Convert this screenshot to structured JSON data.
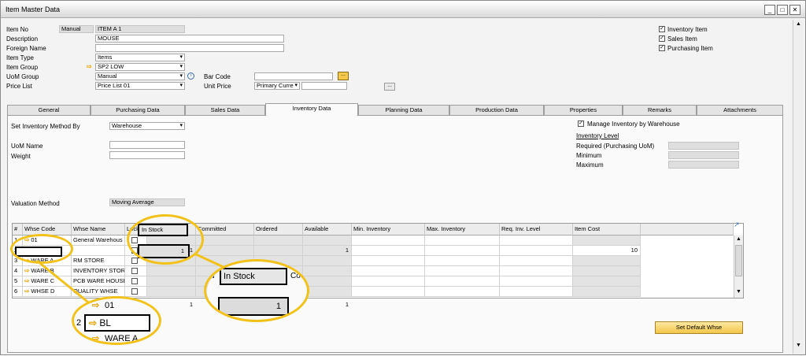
{
  "window": {
    "title": "Item Master Data",
    "min": "_",
    "max": "□",
    "close": "✕"
  },
  "header": {
    "item_no_label": "Item No",
    "item_no_mode": "Manual",
    "item_no_value": "ITEM A 1",
    "description_label": "Description",
    "description_value": "MOUSE",
    "foreign_name_label": "Foreign Name",
    "foreign_name_value": "",
    "item_type_label": "Item Type",
    "item_type_value": "Items",
    "item_group_label": "Item Group",
    "item_group_value": "SP2 LOW",
    "uom_group_label": "UoM Group",
    "uom_group_value": "Manual",
    "price_list_label": "Price List",
    "price_list_value": "Price List 01",
    "bar_code_label": "Bar Code",
    "bar_code_value": "",
    "unit_price_label": "Unit Price",
    "unit_price_currency": "Primary Curre",
    "unit_price_value": "",
    "browse": "...",
    "inventory_item": "Inventory Item",
    "sales_item": "Sales Item",
    "purchasing_item": "Purchasing Item"
  },
  "tabs": [
    "General",
    "Purchasing Data",
    "Sales Data",
    "Inventory Data",
    "Planning Data",
    "Production Data",
    "Properties",
    "Remarks",
    "Attachments"
  ],
  "inventory": {
    "set_method_label": "Set Inventory Method By",
    "set_method_value": "Warehouse",
    "uom_name_label": "UoM Name",
    "uom_name_value": "",
    "weight_label": "Weight",
    "weight_value": "",
    "valuation_label": "Valuation Method",
    "valuation_value": "Moving Average",
    "manage_by_whse": "Manage Inventory by Warehouse",
    "inventory_level": "Inventory Level",
    "required_label": "Required (Purchasing UoM)",
    "minimum_label": "Minimum",
    "maximum_label": "Maximum",
    "set_default_whse": "Set Default Whse"
  },
  "grid": {
    "headers": [
      "#",
      "Whse Code",
      "Whse Name",
      "Locked",
      "In Stock",
      "Committed",
      "Ordered",
      "Available",
      "Min. Inventory",
      "Max. Inventory",
      "Req. Inv. Level",
      "Item Cost"
    ],
    "rows": [
      {
        "n": "1",
        "code": "01",
        "name": "General Warehous",
        "in_stock": "",
        "available": "",
        "cost": ""
      },
      {
        "n": "2",
        "code": "BL",
        "name": "",
        "in_stock": "1",
        "available": "1",
        "cost": "10"
      },
      {
        "n": "3",
        "code": "WARE A",
        "name": "RM STORE",
        "in_stock": "",
        "available": "",
        "cost": ""
      },
      {
        "n": "4",
        "code": "WARE B",
        "name": "INVENTORY STOR",
        "in_stock": "",
        "available": "",
        "cost": ""
      },
      {
        "n": "5",
        "code": "WARE C",
        "name": "PCB WARE HOUSE",
        "in_stock": "",
        "available": "",
        "cost": ""
      },
      {
        "n": "6",
        "code": "WHSE D",
        "name": "QUALITY WHSE",
        "in_stock": "",
        "available": "",
        "cost": ""
      }
    ],
    "total_in_stock": "1",
    "total_available": "1"
  },
  "zoom": {
    "in_stock_header": "In Stock",
    "in_stock_value": "1",
    "partial_header_left": "d",
    "partial_header_right": "Co",
    "row_code_top": "01",
    "row_n": "2",
    "row_code": "BL",
    "row_code_bottom": "WARE A"
  }
}
